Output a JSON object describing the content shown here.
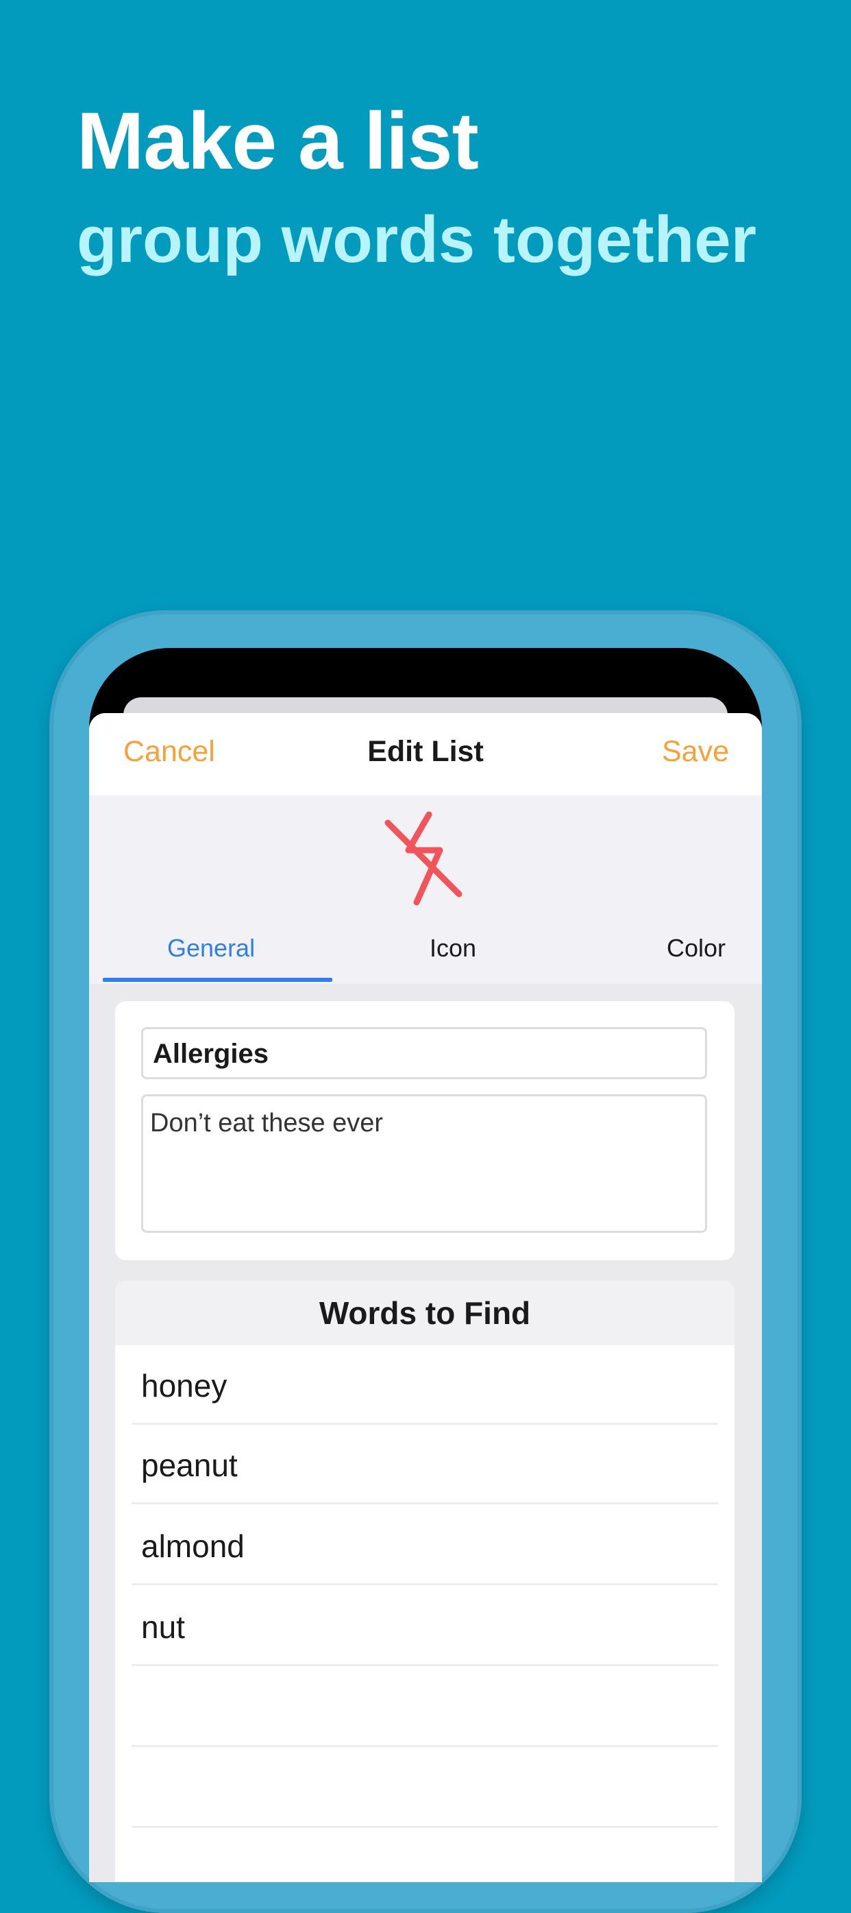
{
  "headline": {
    "title": "Make a list",
    "subtitle": "group words together"
  },
  "sheet": {
    "nav": {
      "cancel_label": "Cancel",
      "title": "Edit List",
      "save_label": "Save"
    },
    "icon": {
      "name": "zap-off-icon",
      "color": "#F2545B"
    },
    "tabs": [
      {
        "label": "General",
        "active": true
      },
      {
        "label": "Icon",
        "active": false
      },
      {
        "label": "Color",
        "active": false
      }
    ],
    "general": {
      "name_value": "Allergies",
      "description_value": "Don’t eat these ever"
    },
    "words": {
      "header": "Words to Find",
      "items": [
        "honey",
        "peanut",
        "almond",
        "nut",
        "",
        ""
      ]
    }
  },
  "colors": {
    "background": "#029BBE",
    "subtitle": "#B8F4FF",
    "accent_orange": "#F6A23A",
    "accent_blue": "#2F7FE6",
    "device_frame": "#4AAED2"
  }
}
